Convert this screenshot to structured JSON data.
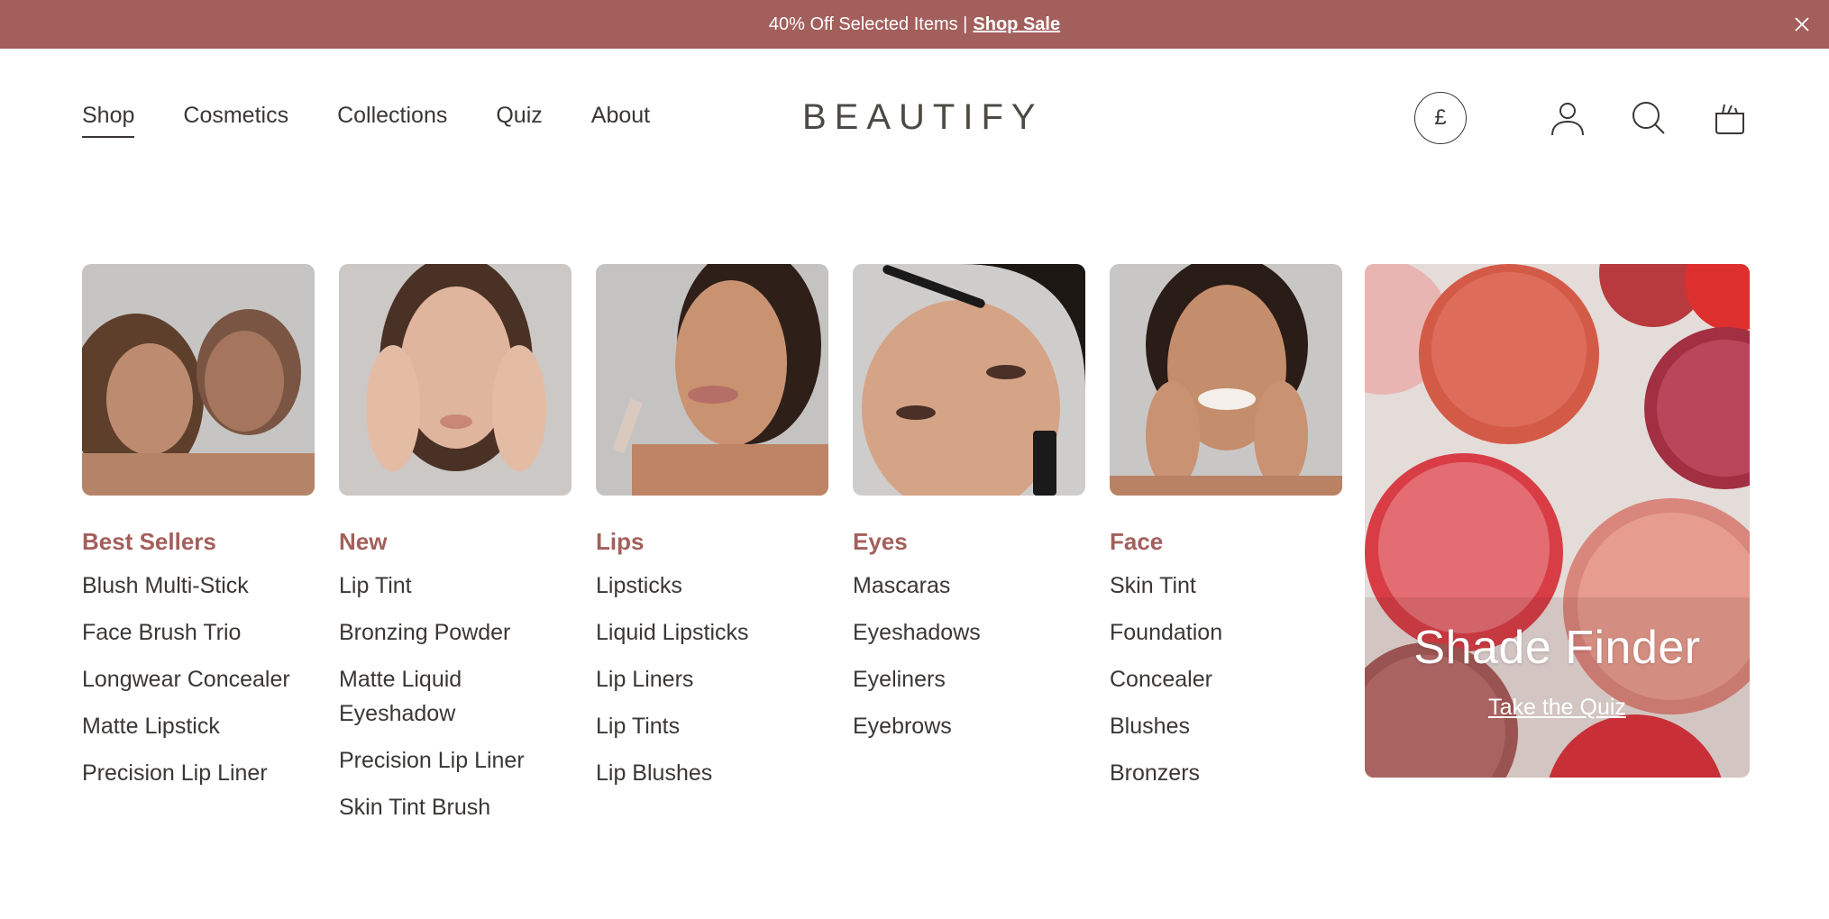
{
  "announcement": {
    "text": "40% Off Selected Items |",
    "link": "Shop Sale"
  },
  "nav": [
    {
      "label": "Shop",
      "active": true
    },
    {
      "label": "Cosmetics"
    },
    {
      "label": "Collections"
    },
    {
      "label": "Quiz"
    },
    {
      "label": "About"
    }
  ],
  "brand": "BEAUTIFY",
  "currency_symbol": "£",
  "icons": [
    "close-icon",
    "account-icon",
    "search-icon",
    "cart-icon"
  ],
  "menu": {
    "columns": [
      {
        "title": "Best Sellers",
        "links": [
          "Blush Multi-Stick",
          "Face Brush Trio",
          "Longwear Concealer",
          "Matte Lipstick",
          "Precision Lip Liner"
        ]
      },
      {
        "title": "New",
        "links": [
          "Lip Tint",
          "Bronzing Powder",
          "Matte Liquid Eyeshadow",
          "Precision Lip Liner",
          "Skin Tint Brush"
        ]
      },
      {
        "title": "Lips",
        "links": [
          "Lipsticks",
          "Liquid Lipsticks",
          "Lip Liners",
          "Lip Tints",
          "Lip Blushes"
        ]
      },
      {
        "title": "Eyes",
        "links": [
          "Mascaras",
          "Eyeshadows",
          "Eyeliners",
          "Eyebrows"
        ]
      },
      {
        "title": "Face",
        "links": [
          "Skin Tint",
          "Foundation",
          "Concealer",
          "Blushes",
          "Bronzers"
        ]
      }
    ]
  },
  "promo": {
    "title": "Shade Finder",
    "cta": "Take the Quiz"
  },
  "colors": {
    "accent": "#a35f5c",
    "text": "#3a3735"
  }
}
